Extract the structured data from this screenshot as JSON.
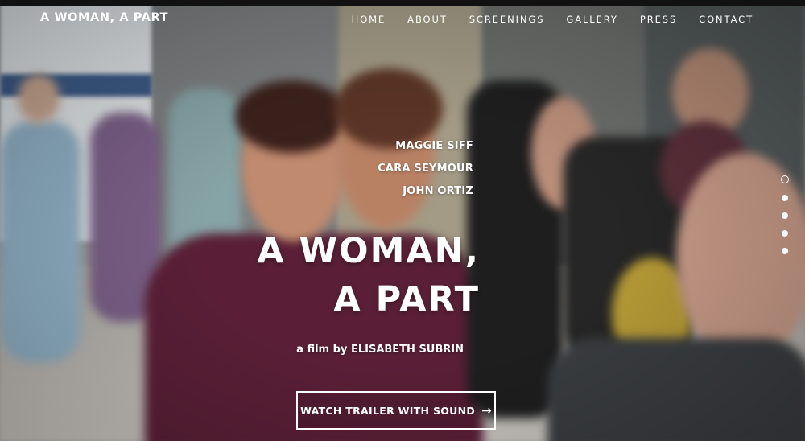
{
  "site": {
    "title": "A WOMAN, A PART"
  },
  "nav": {
    "items": [
      {
        "label": "HOME"
      },
      {
        "label": "ABOUT"
      },
      {
        "label": "SCREENINGS"
      },
      {
        "label": "GALLERY"
      },
      {
        "label": "PRESS"
      },
      {
        "label": "CONTACT"
      }
    ]
  },
  "hero": {
    "cast": [
      "MAGGIE SIFF",
      "CARA SEYMOUR",
      "JOHN ORTIZ"
    ],
    "title_line1": "A WOMAN,",
    "title_line2": "A PART",
    "byline_prefix": "a film by",
    "byline_name": "ELISABETH SUBRIN",
    "cta_label": "WATCH TRAILER WITH SOUND",
    "cta_arrow": "→"
  },
  "slides": {
    "count": 5,
    "active_index": 0
  }
}
